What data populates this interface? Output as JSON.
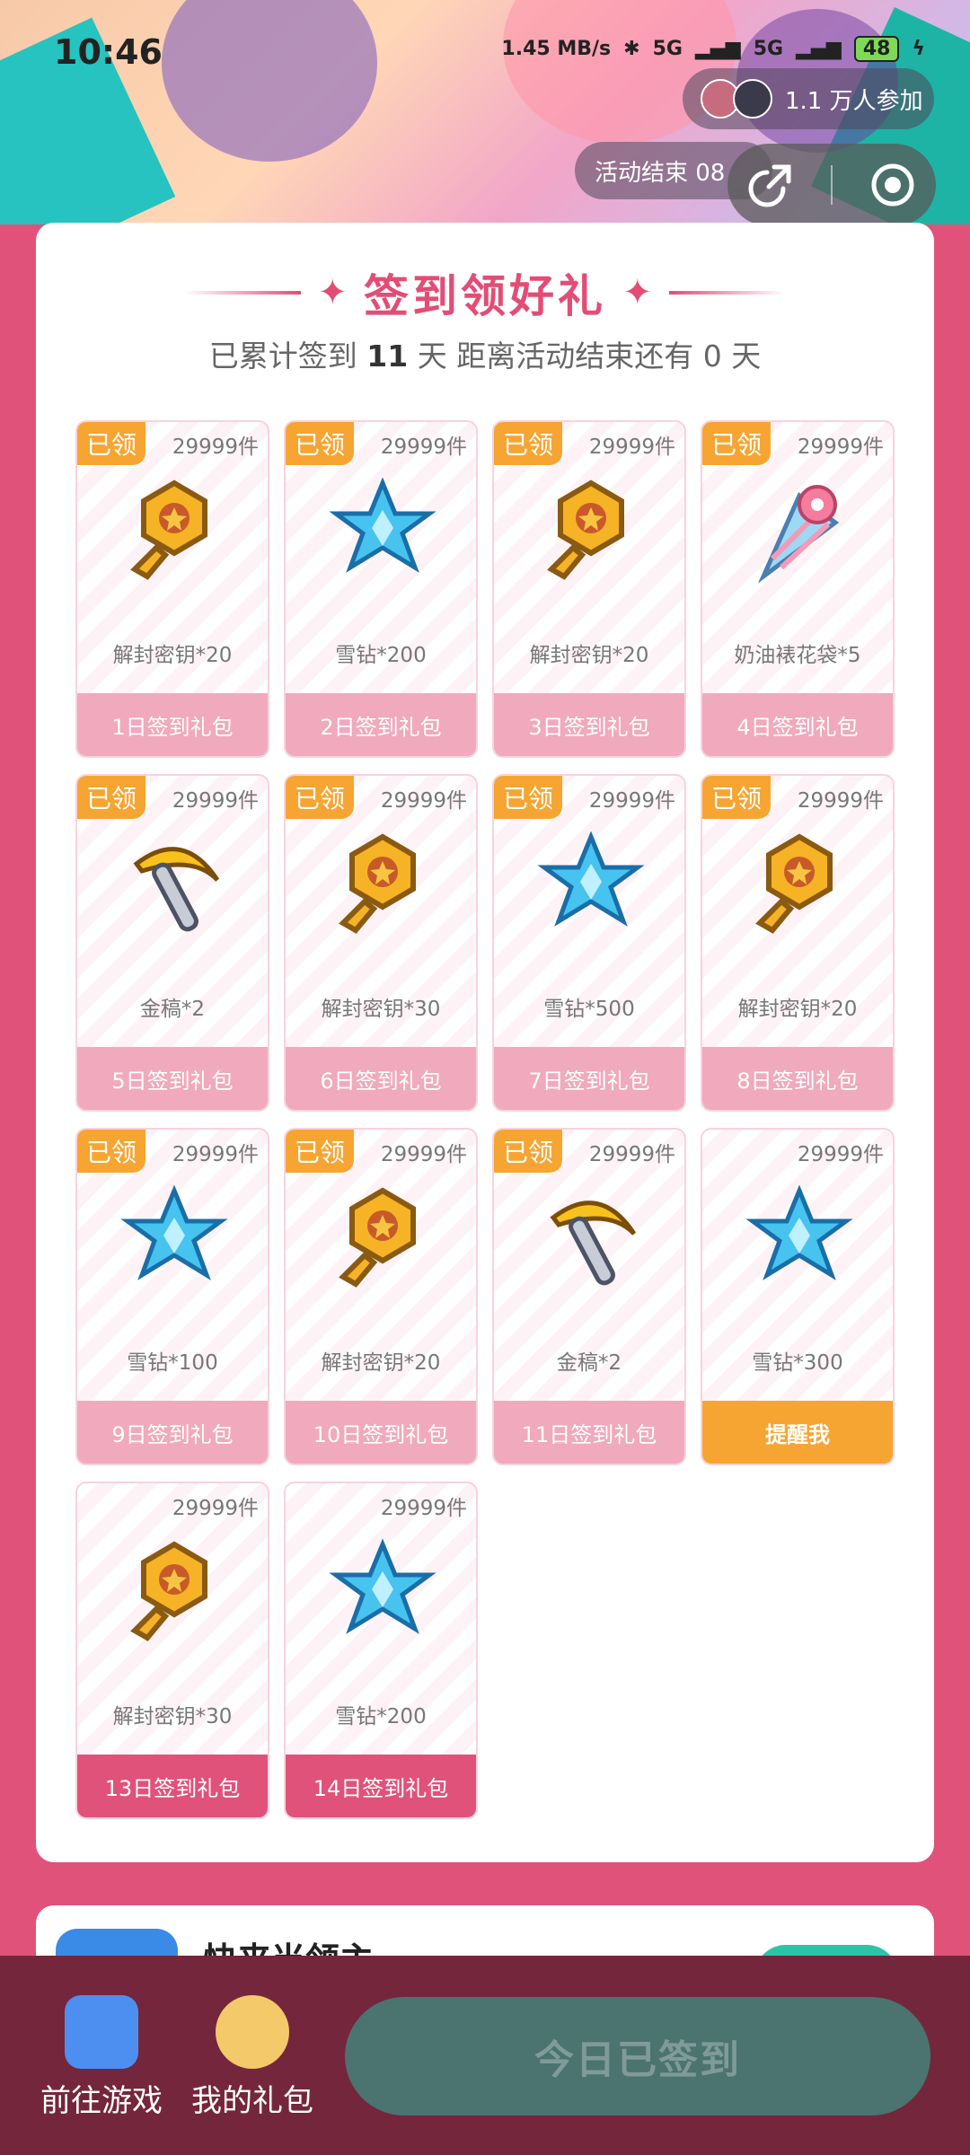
{
  "status_bar": {
    "time": "10:46",
    "net_speed": "1.45 MB/s",
    "signal_1": "5G",
    "signal_2": "5G",
    "battery": "48"
  },
  "header": {
    "participants": "1.1 万人参加",
    "end_label": "活动结束 08"
  },
  "card": {
    "title": "签到领好礼",
    "subtitle_prefix": "已累计签到",
    "signed_days": "11",
    "subtitle_mid": "天  距离活动结束还有",
    "remaining_days": "0",
    "subtitle_suffix": "天"
  },
  "gifts": [
    {
      "claimed": "已领",
      "stock": "29999件",
      "name": "解封密钥*20",
      "button": "1日签到礼包",
      "icon": "key-icon"
    },
    {
      "claimed": "已领",
      "stock": "29999件",
      "name": "雪钻*200",
      "button": "2日签到礼包",
      "icon": "snow-diamond-icon"
    },
    {
      "claimed": "已领",
      "stock": "29999件",
      "name": "解封密钥*20",
      "button": "3日签到礼包",
      "icon": "key-icon"
    },
    {
      "claimed": "已领",
      "stock": "29999件",
      "name": "奶油裱花袋*5",
      "button": "4日签到礼包",
      "icon": "piping-bag-icon"
    },
    {
      "claimed": "已领",
      "stock": "29999件",
      "name": "金稿*2",
      "button": "5日签到礼包",
      "icon": "gold-pickaxe-icon"
    },
    {
      "claimed": "已领",
      "stock": "29999件",
      "name": "解封密钥*30",
      "button": "6日签到礼包",
      "icon": "key-icon"
    },
    {
      "claimed": "已领",
      "stock": "29999件",
      "name": "雪钻*500",
      "button": "7日签到礼包",
      "icon": "snow-diamond-icon"
    },
    {
      "claimed": "已领",
      "stock": "29999件",
      "name": "解封密钥*20",
      "button": "8日签到礼包",
      "icon": "key-icon"
    },
    {
      "claimed": "已领",
      "stock": "29999件",
      "name": "雪钻*100",
      "button": "9日签到礼包",
      "icon": "snow-diamond-icon"
    },
    {
      "claimed": "已领",
      "stock": "29999件",
      "name": "解封密钥*20",
      "button": "10日签到礼包",
      "icon": "key-icon"
    },
    {
      "claimed": "已领",
      "stock": "29999件",
      "name": "金稿*2",
      "button": "11日签到礼包",
      "icon": "gold-pickaxe-icon"
    },
    {
      "claimed": "",
      "stock": "29999件",
      "name": "雪钻*300",
      "button": "提醒我",
      "icon": "snow-diamond-icon"
    },
    {
      "claimed": "",
      "stock": "29999件",
      "name": "解封密钥*30",
      "button": "13日签到礼包",
      "icon": "key-icon"
    },
    {
      "claimed": "",
      "stock": "29999件",
      "name": "雪钻*200",
      "button": "14日签到礼包",
      "icon": "snow-diamond-icon"
    }
  ],
  "next_section": {
    "title": "快来当领主"
  },
  "bottom_bar": {
    "game_label": "前往游戏",
    "gift_label": "我的礼包",
    "signed_button": "今日已签到"
  },
  "colors": {
    "brand_pink": "#e0527a",
    "claimed_orange": "#f6a532",
    "bottom_bar": "#74263c",
    "signed_button": "#4b7370"
  }
}
